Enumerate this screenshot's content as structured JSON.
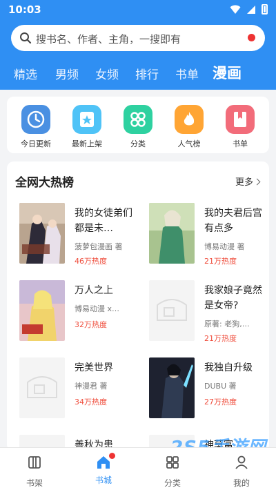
{
  "status_bar": {
    "time": "10:03"
  },
  "search": {
    "placeholder": "搜书名、作者、主角，一搜即有"
  },
  "tabs": [
    {
      "label": "精选"
    },
    {
      "label": "男频"
    },
    {
      "label": "女频"
    },
    {
      "label": "排行"
    },
    {
      "label": "书单"
    },
    {
      "label": "漫画"
    }
  ],
  "categories": [
    {
      "label": "今日更新",
      "icon": "clock-icon",
      "color": "#4a90e2"
    },
    {
      "label": "最新上架",
      "icon": "star-box-icon",
      "color": "#4fc3f7"
    },
    {
      "label": "分类",
      "icon": "grid-icon",
      "color": "#2ed1a0"
    },
    {
      "label": "人气榜",
      "icon": "flame-icon",
      "color": "#ffa534"
    },
    {
      "label": "书单",
      "icon": "bookmark-icon",
      "color": "#f26c7a"
    }
  ],
  "hot": {
    "title": "全网大热榜",
    "more": "更多",
    "books": [
      {
        "title": "我的女徒弟们都是未…",
        "author": "菠萝包漫画 著",
        "heat": "46万热度"
      },
      {
        "title": "我的夫君后宫有点多",
        "author": "博易动漫 著",
        "heat": "21万热度"
      },
      {
        "title": "万人之上",
        "author": "博易动漫 x…",
        "heat": "32万热度"
      },
      {
        "title": "我家娘子竟然是女帝?",
        "author": "原著: 老狗,…",
        "heat": "21万热度"
      },
      {
        "title": "完美世界",
        "author": "神漫君 著",
        "heat": "34万热度"
      },
      {
        "title": "我独自升级",
        "author": "DUBU 著",
        "heat": "27万热度"
      }
    ],
    "partial": [
      "善秋为患",
      "神莫富"
    ]
  },
  "bottom_nav": [
    {
      "label": "书架",
      "icon": "bookshelf-icon"
    },
    {
      "label": "书城",
      "icon": "home-icon"
    },
    {
      "label": "分类",
      "icon": "category-icon"
    },
    {
      "label": "我的",
      "icon": "user-icon"
    }
  ],
  "watermark": "2S5手游网",
  "colors": {
    "primary": "#2f8ff3",
    "heat": "#ef4b3a",
    "badge": "#ee3333"
  }
}
